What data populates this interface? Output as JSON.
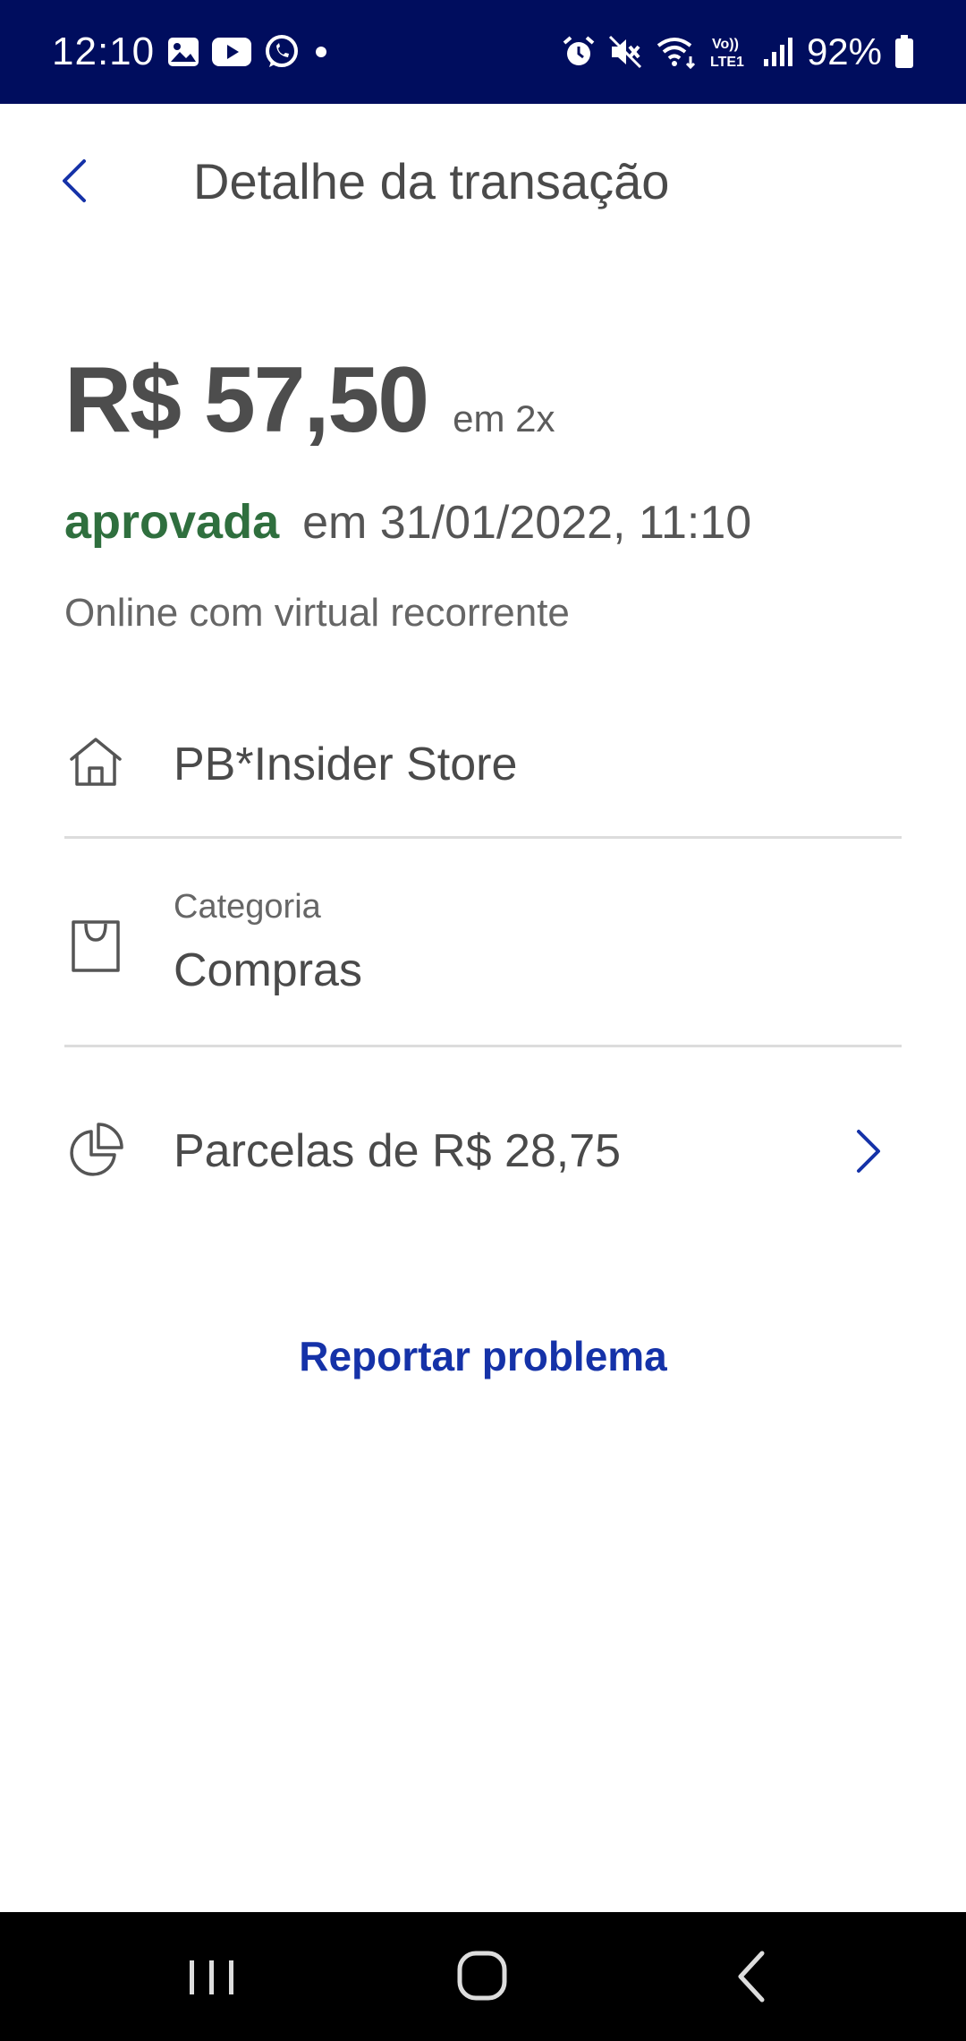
{
  "status_bar": {
    "time": "12:10",
    "battery_percent": "92%",
    "left_icons": [
      "gallery-icon",
      "youtube-icon",
      "whatsapp-icon",
      "dot-icon"
    ],
    "right_icons": [
      "alarm-icon",
      "mute-icon",
      "wifi-icon",
      "volte-icon",
      "signal-icon",
      "battery-icon"
    ]
  },
  "header": {
    "title": "Detalhe da transação"
  },
  "transaction": {
    "amount": "R$ 57,50",
    "installments": "em 2x",
    "status": "aprovada",
    "date": "em 31/01/2022, 11:10",
    "type": "Online com virtual recorrente"
  },
  "details": {
    "merchant": "PB*Insider Store",
    "category_label": "Categoria",
    "category_value": "Compras",
    "installment_info": "Parcelas de R$ 28,75"
  },
  "actions": {
    "report": "Reportar problema"
  },
  "colors": {
    "status_bar_bg": "#000d5e",
    "approved": "#2f6f3e",
    "accent": "#1532a8",
    "text": "#4a4a4a"
  }
}
